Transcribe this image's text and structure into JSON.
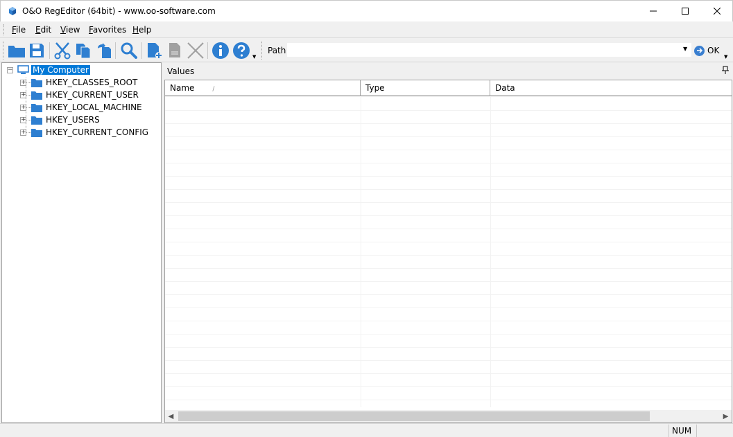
{
  "window": {
    "title": "O&O RegEditor (64bit) - www.oo-software.com"
  },
  "menu": {
    "items": [
      {
        "key": "F",
        "rest": "ile"
      },
      {
        "key": "E",
        "rest": "dit"
      },
      {
        "key": "V",
        "rest": "iew"
      },
      {
        "key": "F",
        "rest": "avorites"
      },
      {
        "key": "H",
        "rest": "elp"
      }
    ]
  },
  "toolbar": {
    "path_label": "Path",
    "path_value": "",
    "ok_label": "OK",
    "icon_color": "#2e7fd1",
    "disabled_color": "#a0a0a0"
  },
  "tree": {
    "root": "My Computer",
    "hives": [
      "HKEY_CLASSES_ROOT",
      "HKEY_CURRENT_USER",
      "HKEY_LOCAL_MACHINE",
      "HKEY_USERS",
      "HKEY_CURRENT_CONFIG"
    ]
  },
  "values": {
    "title": "Values",
    "columns": [
      "Name",
      "Type",
      "Data"
    ],
    "sort_glyph": "/"
  },
  "status": {
    "num": "NUM"
  }
}
